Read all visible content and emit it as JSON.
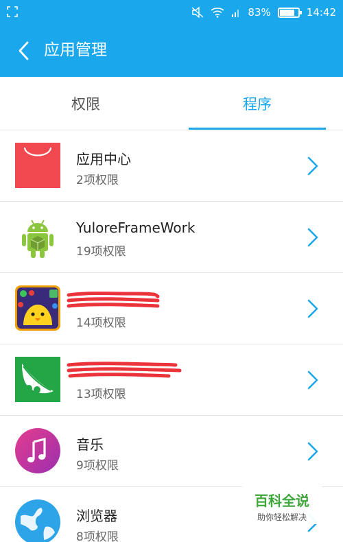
{
  "status_bar": {
    "battery": "83%",
    "battery_level": 0.83,
    "time": "14:42"
  },
  "app_bar": {
    "title": "应用管理"
  },
  "tabs": [
    {
      "label": "权限",
      "selected": false
    },
    {
      "label": "程序",
      "selected": true
    }
  ],
  "apps": [
    {
      "name": "应用中心",
      "permissions": "2项权限",
      "icon": "shopping-bag-icon"
    },
    {
      "name": "YuloreFrameWork",
      "permissions": "19项权限",
      "icon": "android-robot-icon"
    },
    {
      "name": "",
      "permissions": "14项权限",
      "icon": "game-chick-icon",
      "name_redacted": true
    },
    {
      "name": "",
      "permissions": "13项权限",
      "icon": "pea-pod-icon",
      "name_redacted": true
    },
    {
      "name": "音乐",
      "permissions": "9项权限",
      "icon": "music-note-icon"
    },
    {
      "name": "浏览器",
      "permissions": "8项权限",
      "icon": "globe-icon"
    }
  ],
  "watermark": {
    "title": "百科全说",
    "subtitle": "助你轻松解决"
  },
  "colors": {
    "accent": "#1aa7eb"
  }
}
